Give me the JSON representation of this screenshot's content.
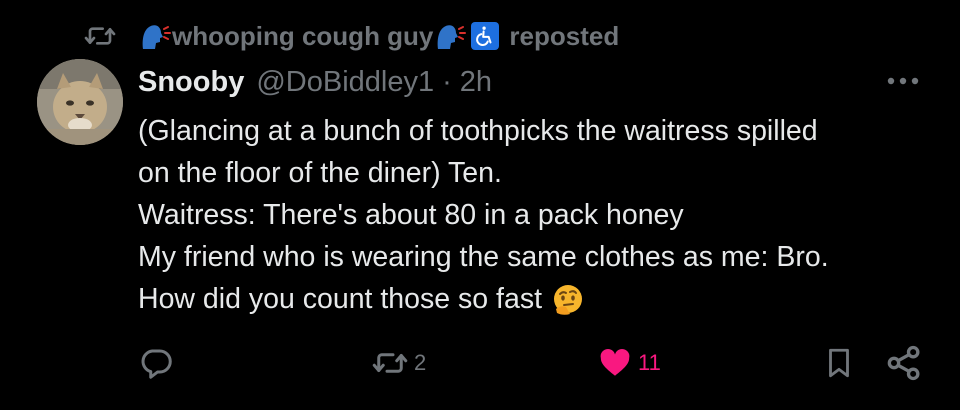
{
  "repost": {
    "reposter_name": "whooping cough guy",
    "label": "reposted"
  },
  "post": {
    "display_name": "Snooby",
    "handle": "@DoBiddley1",
    "separator": "·",
    "time": "2h",
    "lines": [
      "(Glancing at a bunch of toothpicks the waitress spilled",
      "on the floor of the diner) Ten.",
      "Waitress: There's about 80 in a pack honey",
      "My friend who is wearing the same clothes as me: Bro.",
      "How did you count those so fast"
    ],
    "end_emoji": "thinking-face"
  },
  "actions": {
    "reply_count": "",
    "repost_count": "2",
    "like_count": "11",
    "liked": true
  },
  "colors": {
    "background": "#000000",
    "text_primary": "#e7e9ea",
    "text_secondary": "#71767b",
    "like_accent": "#f91880",
    "accessibility_badge": "#1d6fe0"
  },
  "icons": {
    "repost_header": "repost-icon",
    "speaking_head_1": "speaking-head-emoji",
    "speaking_head_2": "speaking-head-emoji",
    "wheelchair": "wheelchair-symbol-emoji",
    "more": "more-horizontal-icon",
    "reply": "reply-icon",
    "repost": "repost-icon",
    "like": "heart-icon",
    "bookmark": "bookmark-icon",
    "share": "share-icon"
  }
}
